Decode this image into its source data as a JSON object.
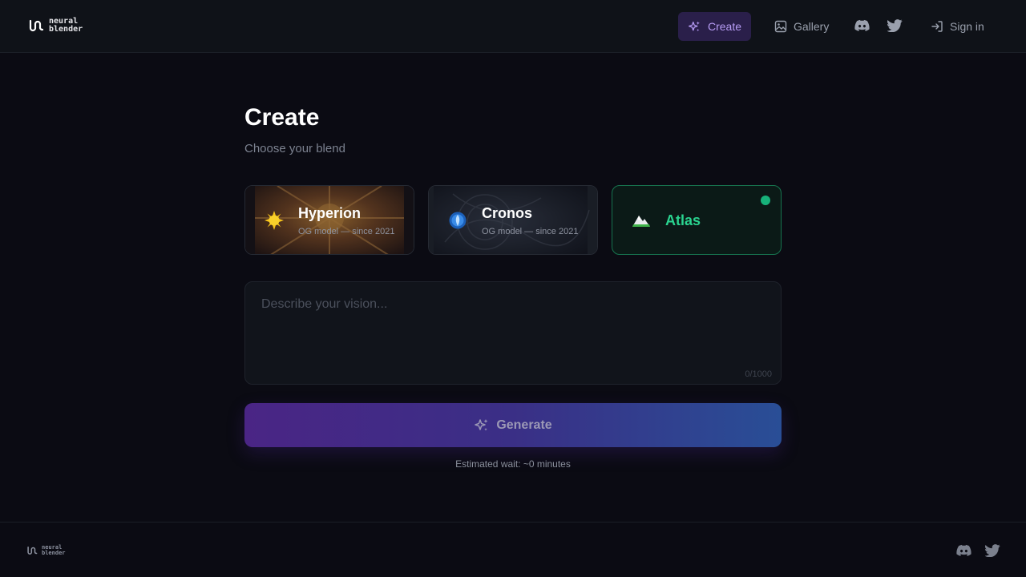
{
  "nav": {
    "logo_line1": "neural",
    "logo_line2": "blender",
    "create_label": "Create",
    "gallery_label": "Gallery",
    "signin_label": "Sign in"
  },
  "main": {
    "title": "Create",
    "subtitle": "Choose your blend",
    "models": [
      {
        "name": "Hyperion",
        "desc": "OG model — since 2021",
        "icon": "sun-icon",
        "selected": false
      },
      {
        "name": "Cronos",
        "desc": "OG model — since 2021",
        "icon": "orb-icon",
        "selected": false
      },
      {
        "name": "Atlas",
        "desc": "",
        "icon": "mountain-icon",
        "selected": true
      }
    ],
    "prompt": {
      "placeholder": "Describe your vision...",
      "value": "",
      "counter": "0/1000"
    },
    "generate_label": "Generate",
    "wait_text": "Estimated wait: ~0 minutes"
  },
  "footer": {
    "logo_line1": "neural",
    "logo_line2": "blender"
  },
  "colors": {
    "background": "#0b0b13",
    "accent_purple": "#b79cf5",
    "accent_green": "#2ad38f",
    "generate_start": "#4a2585",
    "generate_end": "#294e96"
  }
}
